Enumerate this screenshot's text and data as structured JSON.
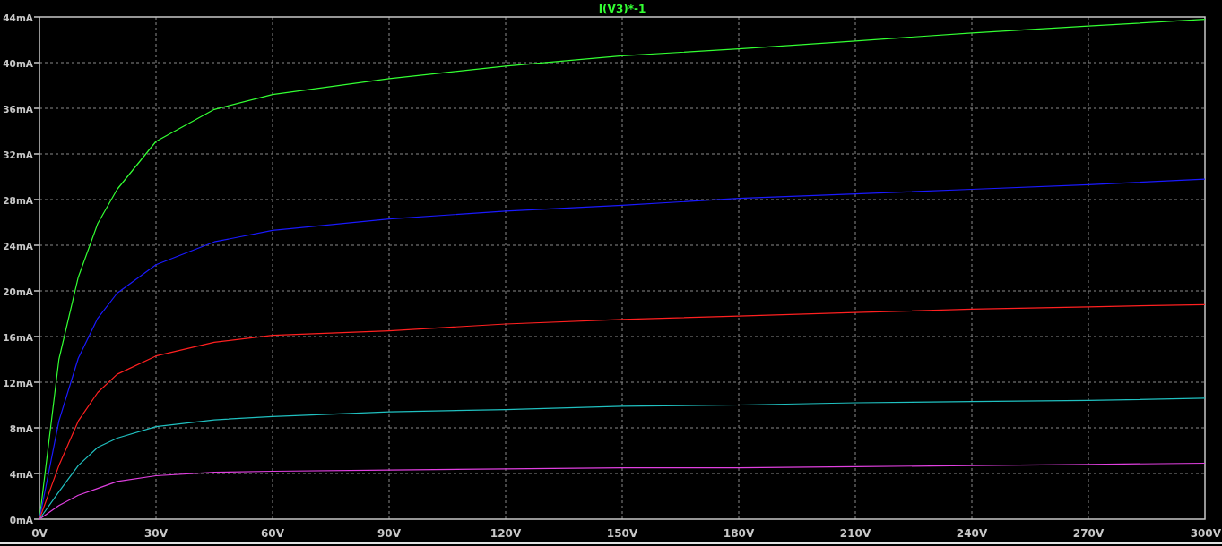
{
  "chart": {
    "chart_data": {
      "type": "line",
      "title": "I(V3)*-1",
      "x": [
        0,
        5,
        10,
        15,
        20,
        30,
        45,
        60,
        90,
        120,
        150,
        180,
        210,
        240,
        270,
        300
      ],
      "series": [
        {
          "color": "#33ff33",
          "values": [
            0,
            14,
            21.2,
            25.9,
            28.9,
            33.1,
            35.9,
            37.2,
            38.6,
            39.7,
            40.6,
            41.2,
            41.9,
            42.6,
            43.2,
            43.8
          ]
        },
        {
          "color": "#1a1aff",
          "values": [
            0,
            8.6,
            14.1,
            17.6,
            19.8,
            22.3,
            24.3,
            25.3,
            26.3,
            27,
            27.5,
            28.1,
            28.5,
            28.9,
            29.3,
            29.8
          ]
        },
        {
          "color": "#ff2020",
          "values": [
            0,
            4.7,
            8.6,
            11.1,
            12.7,
            14.3,
            15.5,
            16.1,
            16.5,
            17.1,
            17.5,
            17.8,
            18.1,
            18.4,
            18.6,
            18.8
          ]
        },
        {
          "color": "#20c0c0",
          "values": [
            0,
            2.4,
            4.7,
            6.3,
            7.1,
            8.1,
            8.7,
            9,
            9.4,
            9.6,
            9.9,
            10,
            10.2,
            10.3,
            10.4,
            10.6
          ]
        },
        {
          "color": "#e040e0",
          "values": [
            0,
            1.2,
            2.1,
            2.7,
            3.3,
            3.8,
            4.1,
            4.2,
            4.3,
            4.4,
            4.5,
            4.5,
            4.6,
            4.7,
            4.8,
            4.9
          ]
        }
      ],
      "grid": true,
      "xlim": [
        0,
        300
      ],
      "ylim": [
        0,
        44
      ],
      "xticks": [
        {
          "value": 0,
          "label": "0V"
        },
        {
          "value": 30,
          "label": "30V"
        },
        {
          "value": 60,
          "label": "60V"
        },
        {
          "value": 90,
          "label": "90V"
        },
        {
          "value": 120,
          "label": "120V"
        },
        {
          "value": 150,
          "label": "150V"
        },
        {
          "value": 180,
          "label": "180V"
        },
        {
          "value": 210,
          "label": "210V"
        },
        {
          "value": 240,
          "label": "240V"
        },
        {
          "value": 270,
          "label": "270V"
        },
        {
          "value": 300,
          "label": "300V"
        }
      ],
      "yticks": [
        {
          "value": 0,
          "label": "0mA"
        },
        {
          "value": 4,
          "label": "4mA"
        },
        {
          "value": 8,
          "label": "8mA"
        },
        {
          "value": 12,
          "label": "12mA"
        },
        {
          "value": 16,
          "label": "16mA"
        },
        {
          "value": 20,
          "label": "20mA"
        },
        {
          "value": 24,
          "label": "24mA"
        },
        {
          "value": 28,
          "label": "28mA"
        },
        {
          "value": 32,
          "label": "32mA"
        },
        {
          "value": 36,
          "label": "36mA"
        },
        {
          "value": 40,
          "label": "40mA"
        },
        {
          "value": 44,
          "label": "44mA"
        }
      ]
    }
  }
}
